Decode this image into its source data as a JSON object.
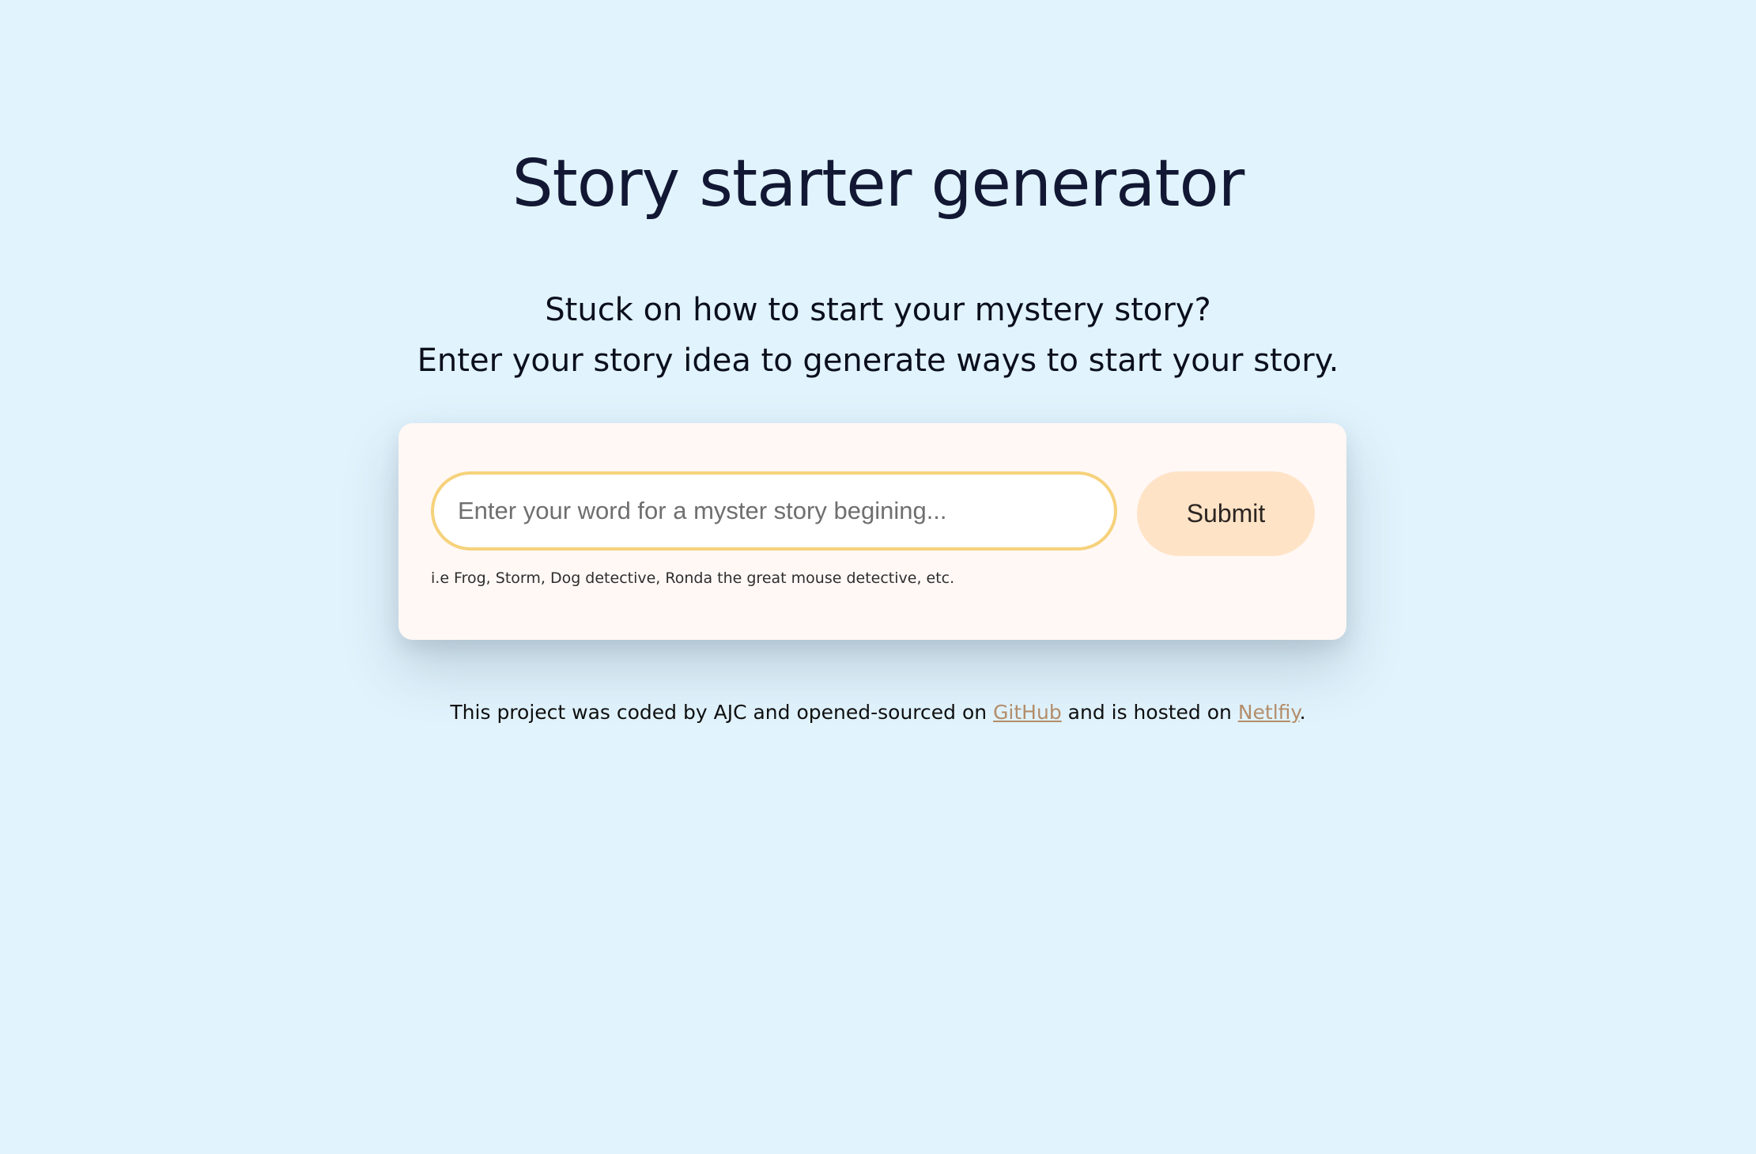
{
  "header": {
    "title": "Story starter generator"
  },
  "intro": {
    "line1": "Stuck on how to start your mystery story?",
    "line2": "Enter your story idea to generate ways to start your story."
  },
  "form": {
    "input_value": "",
    "input_placeholder": "Enter your word for a myster story begining...",
    "submit_label": "Submit",
    "hint": "i.e Frog, Storm, Dog detective, Ronda the great mouse detective, etc."
  },
  "footer": {
    "text_before": "This project was coded by AJC and opened-sourced on ",
    "github_link": "GitHub",
    "text_middle": " and is hosted on ",
    "netlify_link": "Netlfiy",
    "text_after": "."
  },
  "colors": {
    "background": "#e1f3fd",
    "card": "#fff8f5",
    "input_border": "#f6d27c",
    "button": "#ffe3c6",
    "link": "#b38d6a"
  }
}
